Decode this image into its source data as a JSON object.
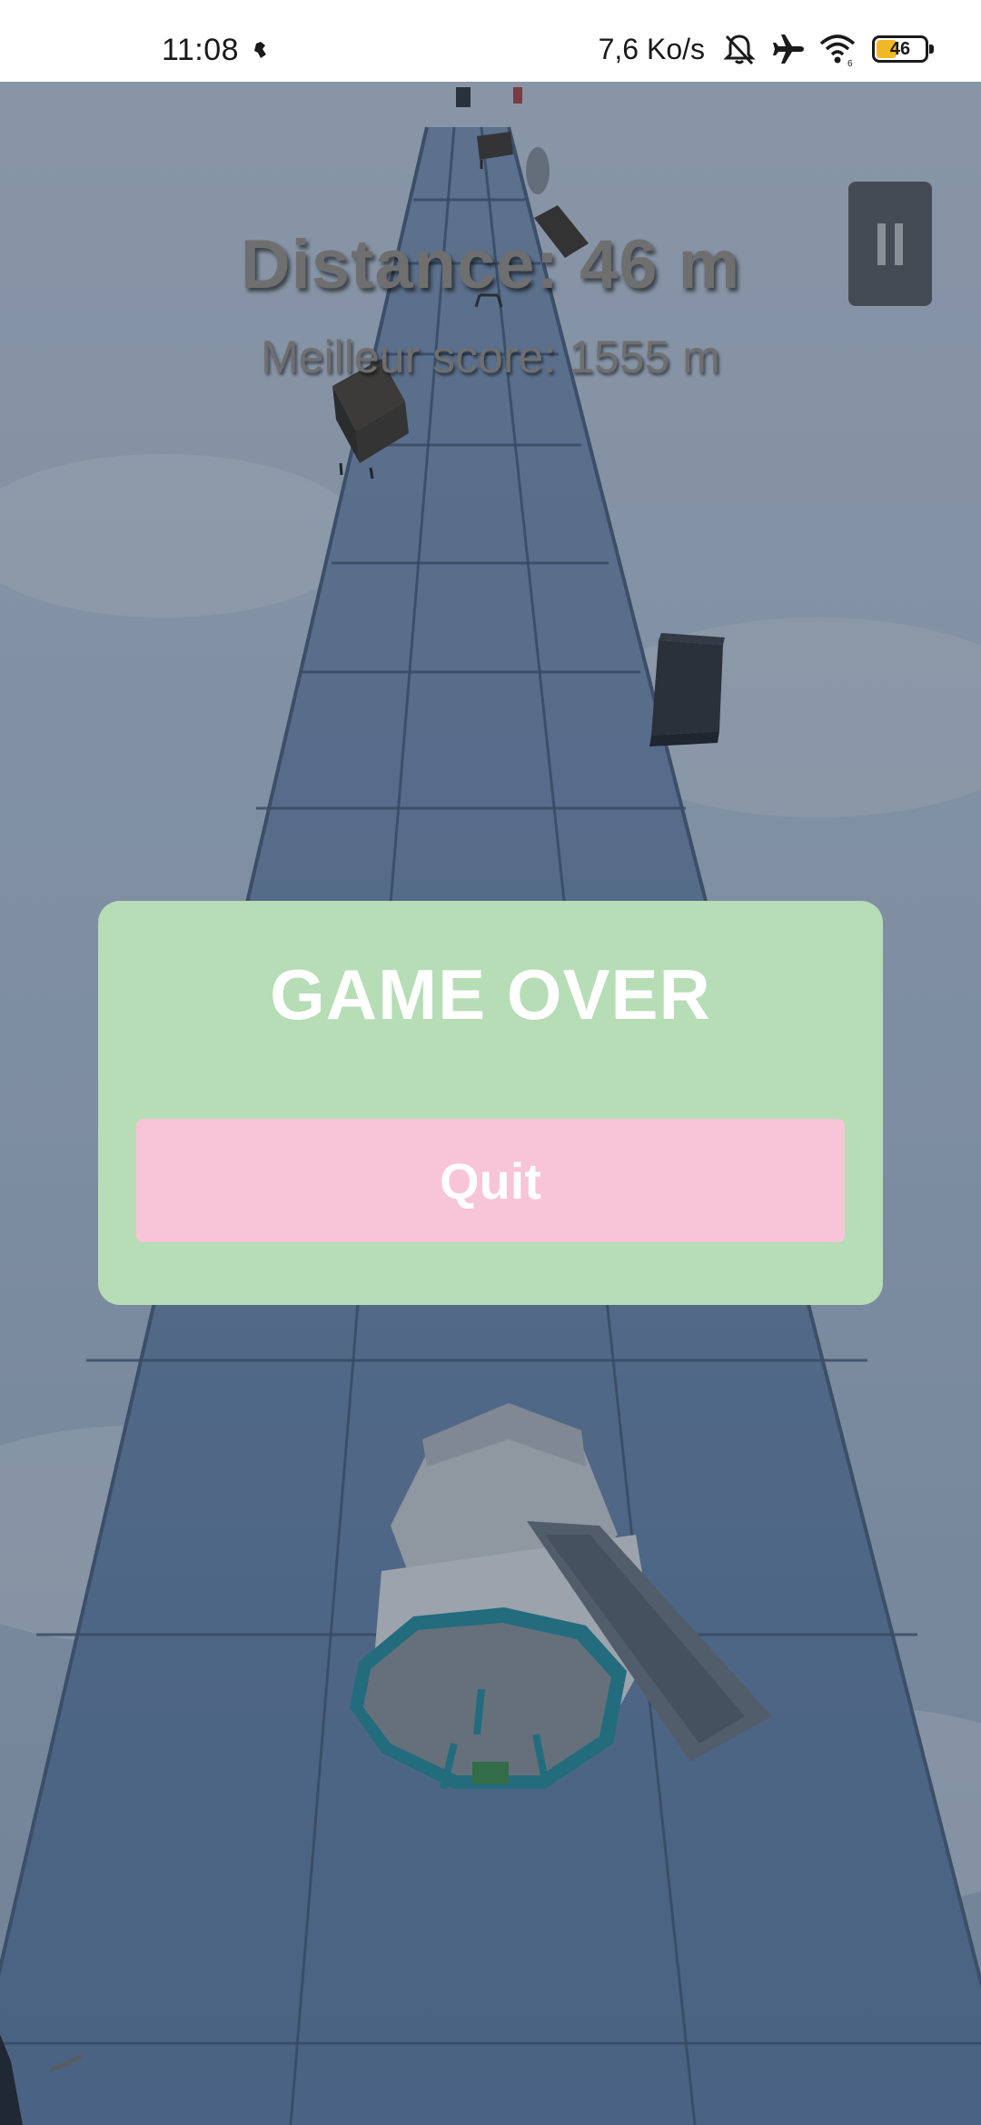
{
  "status_bar": {
    "time": "11:08",
    "speed": "7,6 Ko/s",
    "battery_level": "46",
    "battery_percent": 46,
    "icons": [
      "app-notification-icon",
      "bell-muted-icon",
      "airplane-mode-icon",
      "wifi-icon",
      "battery-icon"
    ]
  },
  "hud": {
    "distance": "Distance: 46 m",
    "best_score": "Meilleur score: 1555 m"
  },
  "game_over": {
    "title": "GAME OVER",
    "quit_label": "Quit"
  },
  "colors": {
    "panel": "#b6ddb6",
    "quit_button": "#f8c4d8",
    "hud_text": "#6f6f6f",
    "battery_fill": "#f2b824"
  }
}
